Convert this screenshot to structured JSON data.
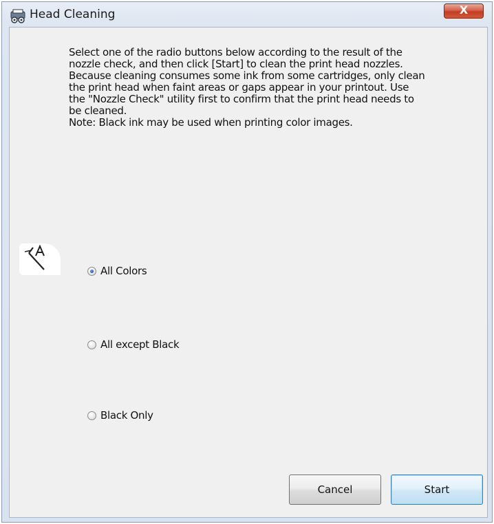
{
  "window": {
    "title": "Head Cleaning",
    "close_label": "X"
  },
  "description": {
    "lines": [
      "Select one of the radio buttons below according to the result of the",
      "nozzle check, and then click [Start] to clean the print head nozzles.",
      "Because cleaning consumes some ink from some cartridges, only clean",
      "the print head when faint areas or gaps appear in your printout. Use",
      "the \"Nozzle Check\" utility first to confirm that the print head needs to",
      "be cleaned.",
      "Note: Black ink may be used when printing color images."
    ]
  },
  "options": [
    {
      "label": "All Colors",
      "checked": true
    },
    {
      "label": "All except Black",
      "checked": false
    },
    {
      "label": "Black Only",
      "checked": false
    }
  ],
  "buttons": {
    "cancel": "Cancel",
    "start": "Start"
  },
  "colors": {
    "close_button": "#c9482c",
    "radio_selected": "#1d4fa8",
    "start_button_border": "#3c7fb1"
  }
}
